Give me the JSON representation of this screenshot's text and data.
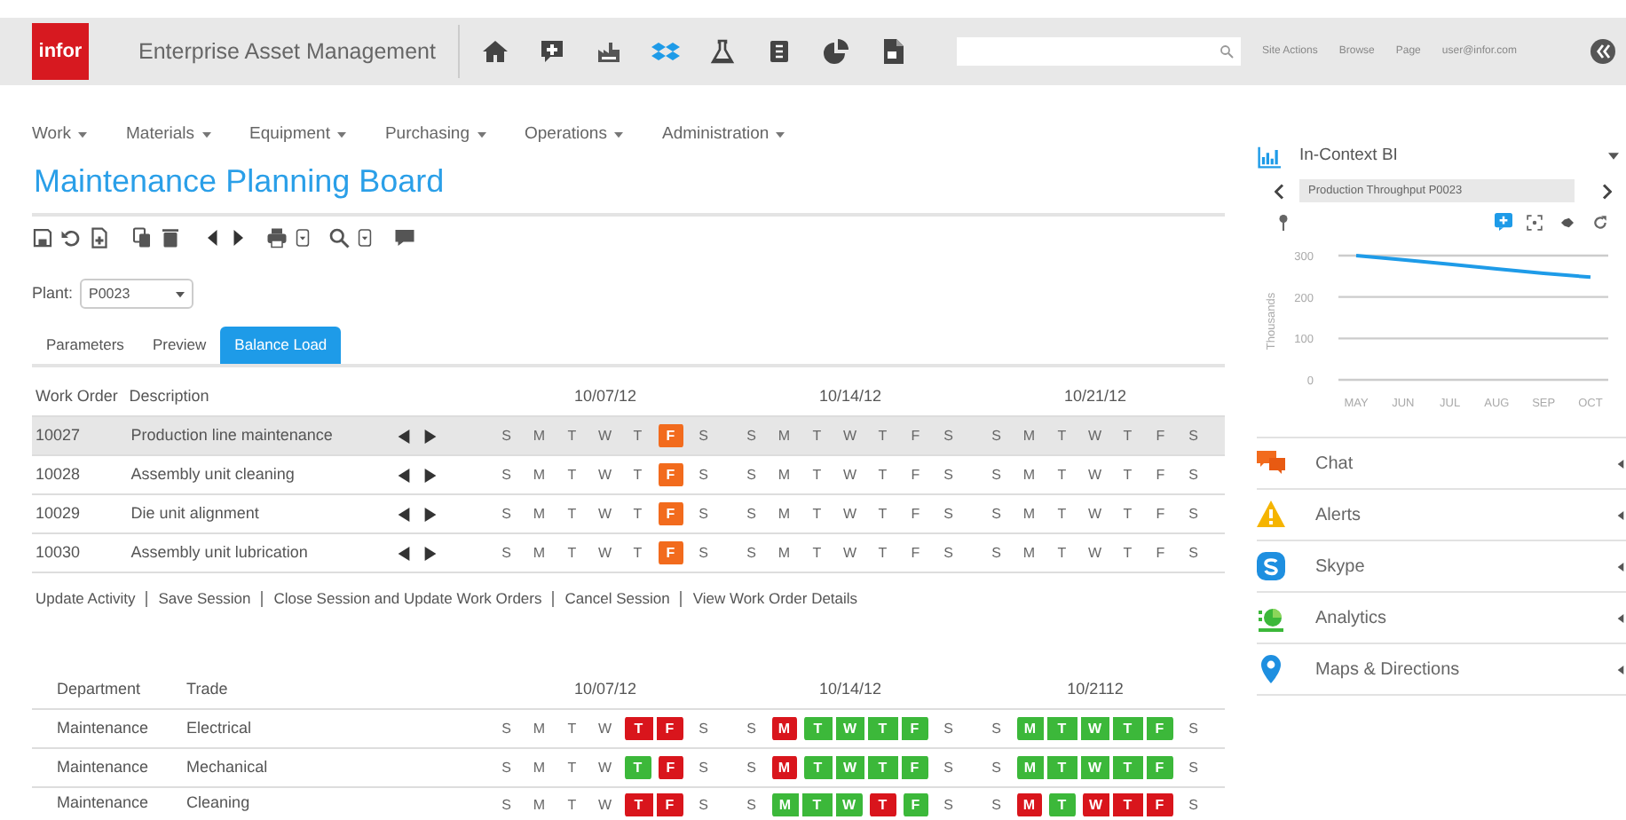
{
  "header": {
    "logo": "infor",
    "app_title": "Enterprise Asset Management",
    "top_links": [
      "Site Actions",
      "Browse",
      "Page",
      "user@infor.com"
    ]
  },
  "menu": [
    {
      "label": "Work"
    },
    {
      "label": "Materials"
    },
    {
      "label": "Equipment"
    },
    {
      "label": "Purchasing"
    },
    {
      "label": "Operations"
    },
    {
      "label": "Administration"
    }
  ],
  "page_title": "Maintenance Planning Board",
  "plant": {
    "label": "Plant:",
    "value": "P0023"
  },
  "tabs": [
    {
      "label": "Parameters",
      "selected": false
    },
    {
      "label": "Preview",
      "selected": false
    },
    {
      "label": "Balance Load",
      "selected": true
    }
  ],
  "work_orders": {
    "columns": [
      "Work Order",
      "Description"
    ],
    "weeks": [
      "10/07/12",
      "10/14/12",
      "10/21/12"
    ],
    "rows": [
      {
        "id": "10027",
        "description": "Production line maintenance",
        "selected": true,
        "weeks": [
          [
            {
              "label": "S"
            },
            {
              "label": "M"
            },
            {
              "label": "T"
            },
            {
              "label": "W"
            },
            {
              "label": "T"
            },
            {
              "label": "F",
              "color": "#f26b1d"
            },
            {
              "label": "S"
            }
          ],
          [
            {
              "label": "S"
            },
            {
              "label": "M"
            },
            {
              "label": "T"
            },
            {
              "label": "W"
            },
            {
              "label": "T"
            },
            {
              "label": "F"
            },
            {
              "label": "S"
            }
          ],
          [
            {
              "label": "S"
            },
            {
              "label": "M"
            },
            {
              "label": "T"
            },
            {
              "label": "W"
            },
            {
              "label": "T"
            },
            {
              "label": "F"
            },
            {
              "label": "S"
            }
          ]
        ]
      },
      {
        "id": "10028",
        "description": "Assembly unit cleaning",
        "selected": false,
        "weeks": [
          [
            {
              "label": "S"
            },
            {
              "label": "M"
            },
            {
              "label": "T"
            },
            {
              "label": "W"
            },
            {
              "label": "T"
            },
            {
              "label": "F",
              "color": "#f26b1d"
            },
            {
              "label": "S"
            }
          ],
          [
            {
              "label": "S"
            },
            {
              "label": "M"
            },
            {
              "label": "T"
            },
            {
              "label": "W"
            },
            {
              "label": "T"
            },
            {
              "label": "F"
            },
            {
              "label": "S"
            }
          ],
          [
            {
              "label": "S"
            },
            {
              "label": "M"
            },
            {
              "label": "T"
            },
            {
              "label": "W"
            },
            {
              "label": "T"
            },
            {
              "label": "F"
            },
            {
              "label": "S"
            }
          ]
        ]
      },
      {
        "id": "10029",
        "description": "Die unit alignment",
        "selected": false,
        "weeks": [
          [
            {
              "label": "S"
            },
            {
              "label": "M"
            },
            {
              "label": "T"
            },
            {
              "label": "W"
            },
            {
              "label": "T"
            },
            {
              "label": "F",
              "color": "#f26b1d"
            },
            {
              "label": "S"
            }
          ],
          [
            {
              "label": "S"
            },
            {
              "label": "M"
            },
            {
              "label": "T"
            },
            {
              "label": "W"
            },
            {
              "label": "T"
            },
            {
              "label": "F"
            },
            {
              "label": "S"
            }
          ],
          [
            {
              "label": "S"
            },
            {
              "label": "M"
            },
            {
              "label": "T"
            },
            {
              "label": "W"
            },
            {
              "label": "T"
            },
            {
              "label": "F"
            },
            {
              "label": "S"
            }
          ]
        ]
      },
      {
        "id": "10030",
        "description": "Assembly unit lubrication",
        "selected": false,
        "weeks": [
          [
            {
              "label": "S"
            },
            {
              "label": "M"
            },
            {
              "label": "T"
            },
            {
              "label": "W"
            },
            {
              "label": "T"
            },
            {
              "label": "F",
              "color": "#f26b1d"
            },
            {
              "label": "S"
            }
          ],
          [
            {
              "label": "S"
            },
            {
              "label": "M"
            },
            {
              "label": "T"
            },
            {
              "label": "W"
            },
            {
              "label": "T"
            },
            {
              "label": "F"
            },
            {
              "label": "S"
            }
          ],
          [
            {
              "label": "S"
            },
            {
              "label": "M"
            },
            {
              "label": "T"
            },
            {
              "label": "W"
            },
            {
              "label": "T"
            },
            {
              "label": "F"
            },
            {
              "label": "S"
            }
          ]
        ]
      }
    ]
  },
  "actions": [
    "Update Activity",
    "Save Session",
    "Close Session and Update Work Orders",
    "Cancel Session",
    "View Work Order Details"
  ],
  "resources": {
    "columns": [
      "Department",
      "Trade"
    ],
    "weeks": [
      "10/07/12",
      "10/14/12",
      "10/2112"
    ],
    "rows": [
      {
        "department": "Maintenance",
        "trade": "Electrical",
        "weeks": [
          [
            {
              "label": "S"
            },
            {
              "label": "M"
            },
            {
              "label": "T"
            },
            {
              "label": "W"
            },
            {
              "label": "T",
              "color": "#d9151c"
            },
            {
              "label": "F",
              "color": "#d9151c"
            },
            {
              "label": "S"
            }
          ],
          [
            {
              "label": "S"
            },
            {
              "label": "M",
              "color": "#d9151c"
            },
            {
              "label": "T",
              "color": "#3cb83a"
            },
            {
              "label": "W",
              "color": "#3cb83a"
            },
            {
              "label": "T",
              "color": "#3cb83a"
            },
            {
              "label": "F",
              "color": "#3cb83a"
            },
            {
              "label": "S"
            }
          ],
          [
            {
              "label": "S"
            },
            {
              "label": "M",
              "color": "#3cb83a"
            },
            {
              "label": "T",
              "color": "#3cb83a"
            },
            {
              "label": "W",
              "color": "#3cb83a"
            },
            {
              "label": "T",
              "color": "#3cb83a"
            },
            {
              "label": "F",
              "color": "#3cb83a"
            },
            {
              "label": "S"
            }
          ]
        ]
      },
      {
        "department": "Maintenance",
        "trade": "Mechanical",
        "weeks": [
          [
            {
              "label": "S"
            },
            {
              "label": "M"
            },
            {
              "label": "T"
            },
            {
              "label": "W"
            },
            {
              "label": "T",
              "color": "#3cb83a"
            },
            {
              "label": "F",
              "color": "#d9151c"
            },
            {
              "label": "S"
            }
          ],
          [
            {
              "label": "S"
            },
            {
              "label": "M",
              "color": "#d9151c"
            },
            {
              "label": "T",
              "color": "#3cb83a"
            },
            {
              "label": "W",
              "color": "#3cb83a"
            },
            {
              "label": "T",
              "color": "#3cb83a"
            },
            {
              "label": "F",
              "color": "#3cb83a"
            },
            {
              "label": "S"
            }
          ],
          [
            {
              "label": "S"
            },
            {
              "label": "M",
              "color": "#3cb83a"
            },
            {
              "label": "T",
              "color": "#3cb83a"
            },
            {
              "label": "W",
              "color": "#3cb83a"
            },
            {
              "label": "T",
              "color": "#3cb83a"
            },
            {
              "label": "F",
              "color": "#3cb83a"
            },
            {
              "label": "S"
            }
          ]
        ]
      },
      {
        "department": "Maintenance",
        "trade": "Cleaning",
        "weeks": [
          [
            {
              "label": "S"
            },
            {
              "label": "M"
            },
            {
              "label": "T"
            },
            {
              "label": "W"
            },
            {
              "label": "T",
              "color": "#d9151c"
            },
            {
              "label": "F",
              "color": "#d9151c"
            },
            {
              "label": "S"
            }
          ],
          [
            {
              "label": "S"
            },
            {
              "label": "M",
              "color": "#3cb83a"
            },
            {
              "label": "T",
              "color": "#3cb83a"
            },
            {
              "label": "W",
              "color": "#3cb83a"
            },
            {
              "label": "T",
              "color": "#d9151c"
            },
            {
              "label": "F",
              "color": "#3cb83a"
            },
            {
              "label": "S"
            }
          ],
          [
            {
              "label": "S"
            },
            {
              "label": "M",
              "color": "#d9151c"
            },
            {
              "label": "T",
              "color": "#3cb83a"
            },
            {
              "label": "W",
              "color": "#d9151c"
            },
            {
              "label": "T",
              "color": "#d9151c"
            },
            {
              "label": "F",
              "color": "#d9151c"
            },
            {
              "label": "S"
            }
          ]
        ]
      }
    ]
  },
  "bi": {
    "title": "In-Context BI",
    "selector": "Production Throughput P0023",
    "chart_data": {
      "type": "line",
      "ylabel": "Thousands",
      "categories": [
        "MAY",
        "JUN",
        "JUL",
        "AUG",
        "SEP",
        "OCT"
      ],
      "yticks": [
        0,
        100,
        200,
        300
      ],
      "ylim": [
        0,
        300
      ],
      "series": [
        {
          "color": "#1e9be8",
          "values": [
            300,
            290,
            279,
            268,
            257,
            248
          ]
        }
      ]
    }
  },
  "side_items": [
    {
      "label": "Chat",
      "kind": "chat"
    },
    {
      "label": "Alerts",
      "kind": "alert"
    },
    {
      "label": "Skype",
      "kind": "skype"
    },
    {
      "label": "Analytics",
      "kind": "analytics"
    },
    {
      "label": "Maps & Directions",
      "kind": "map"
    }
  ]
}
